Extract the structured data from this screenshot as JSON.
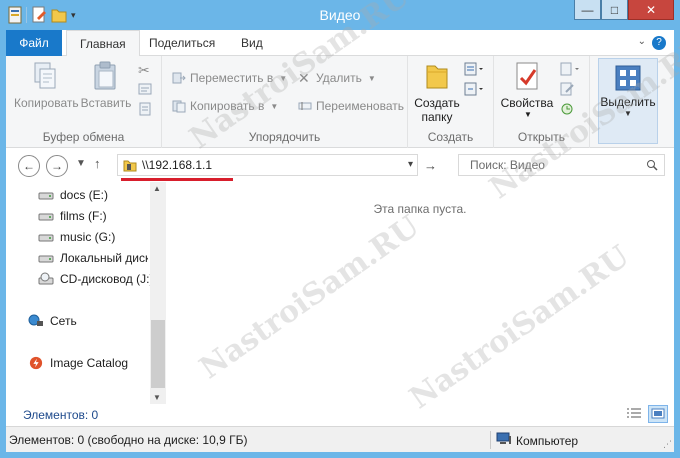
{
  "window": {
    "title": "Видео",
    "accent": "#6bb6e8"
  },
  "quick_access": [
    "properties-icon",
    "new-doc-icon",
    "folder-icon",
    "dropdown-icon"
  ],
  "title_buttons": {
    "minimize": "—",
    "maximize": "□",
    "close": "✕"
  },
  "tabs": [
    {
      "label": "Файл"
    },
    {
      "label": "Главная"
    },
    {
      "label": "Поделиться"
    },
    {
      "label": "Вид"
    }
  ],
  "ribbon": {
    "clipboard": {
      "label": "Буфер обмена",
      "copy": "Копировать",
      "paste": "Вставить"
    },
    "organize": {
      "label": "Упорядочить",
      "move_to": "Переместить в",
      "copy_to": "Копировать в",
      "delete": "Удалить",
      "rename": "Переименовать"
    },
    "create": {
      "label": "Создать",
      "new_folder_line1": "Создать",
      "new_folder_line2": "папку"
    },
    "open": {
      "label": "Открыть",
      "properties": "Свойства"
    },
    "select": {
      "label": "Выделить"
    }
  },
  "address": {
    "path": "\\\\192.168.1.1",
    "search_placeholder": "Поиск: Видео"
  },
  "nav_pane": {
    "items": [
      {
        "label": "docs (E:)",
        "icon": "drive-icon"
      },
      {
        "label": "films (F:)",
        "icon": "drive-icon"
      },
      {
        "label": "music (G:)",
        "icon": "drive-icon"
      },
      {
        "label": "Локальный диск",
        "icon": "drive-icon"
      },
      {
        "label": "CD-дисковод (J:)",
        "icon": "cd-drive-icon"
      },
      {
        "label": "Сеть",
        "icon": "network-icon"
      },
      {
        "label": "Image Catalog",
        "icon": "image-catalog-icon"
      }
    ]
  },
  "content": {
    "empty_message": "Эта папка пуста."
  },
  "items_count": "Элементов: 0",
  "status": {
    "text": "Элементов: 0 (свободно на диске: 10,9 ГБ)",
    "computer": "Компьютер"
  },
  "watermark": "NastroiSam.RU"
}
